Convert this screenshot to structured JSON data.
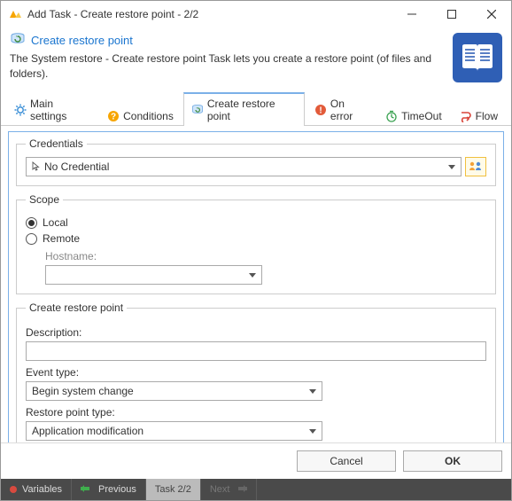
{
  "titlebar": {
    "text": "Add Task - Create restore point - 2/2"
  },
  "header": {
    "title": "Create restore point",
    "description": "The System restore - Create restore point Task lets you create a restore point (of files and folders)."
  },
  "tabs": {
    "main": "Main settings",
    "conditions": "Conditions",
    "restore": "Create restore point",
    "onerror": "On error",
    "timeout": "TimeOut",
    "flow": "Flow"
  },
  "credentials": {
    "legend": "Credentials",
    "selected": "No Credential"
  },
  "scope": {
    "legend": "Scope",
    "local": "Local",
    "remote": "Remote",
    "hostname_label": "Hostname:",
    "hostname_value": ""
  },
  "restore": {
    "legend": "Create restore point",
    "description_label": "Description:",
    "description_value": "",
    "event_label": "Event type:",
    "event_value": "Begin system change",
    "point_label": "Restore point type:",
    "point_value": "Application modification"
  },
  "footer": {
    "cancel": "Cancel",
    "ok": "OK"
  },
  "status": {
    "variables": "Variables",
    "previous": "Previous",
    "task": "Task 2/2",
    "next": "Next"
  }
}
